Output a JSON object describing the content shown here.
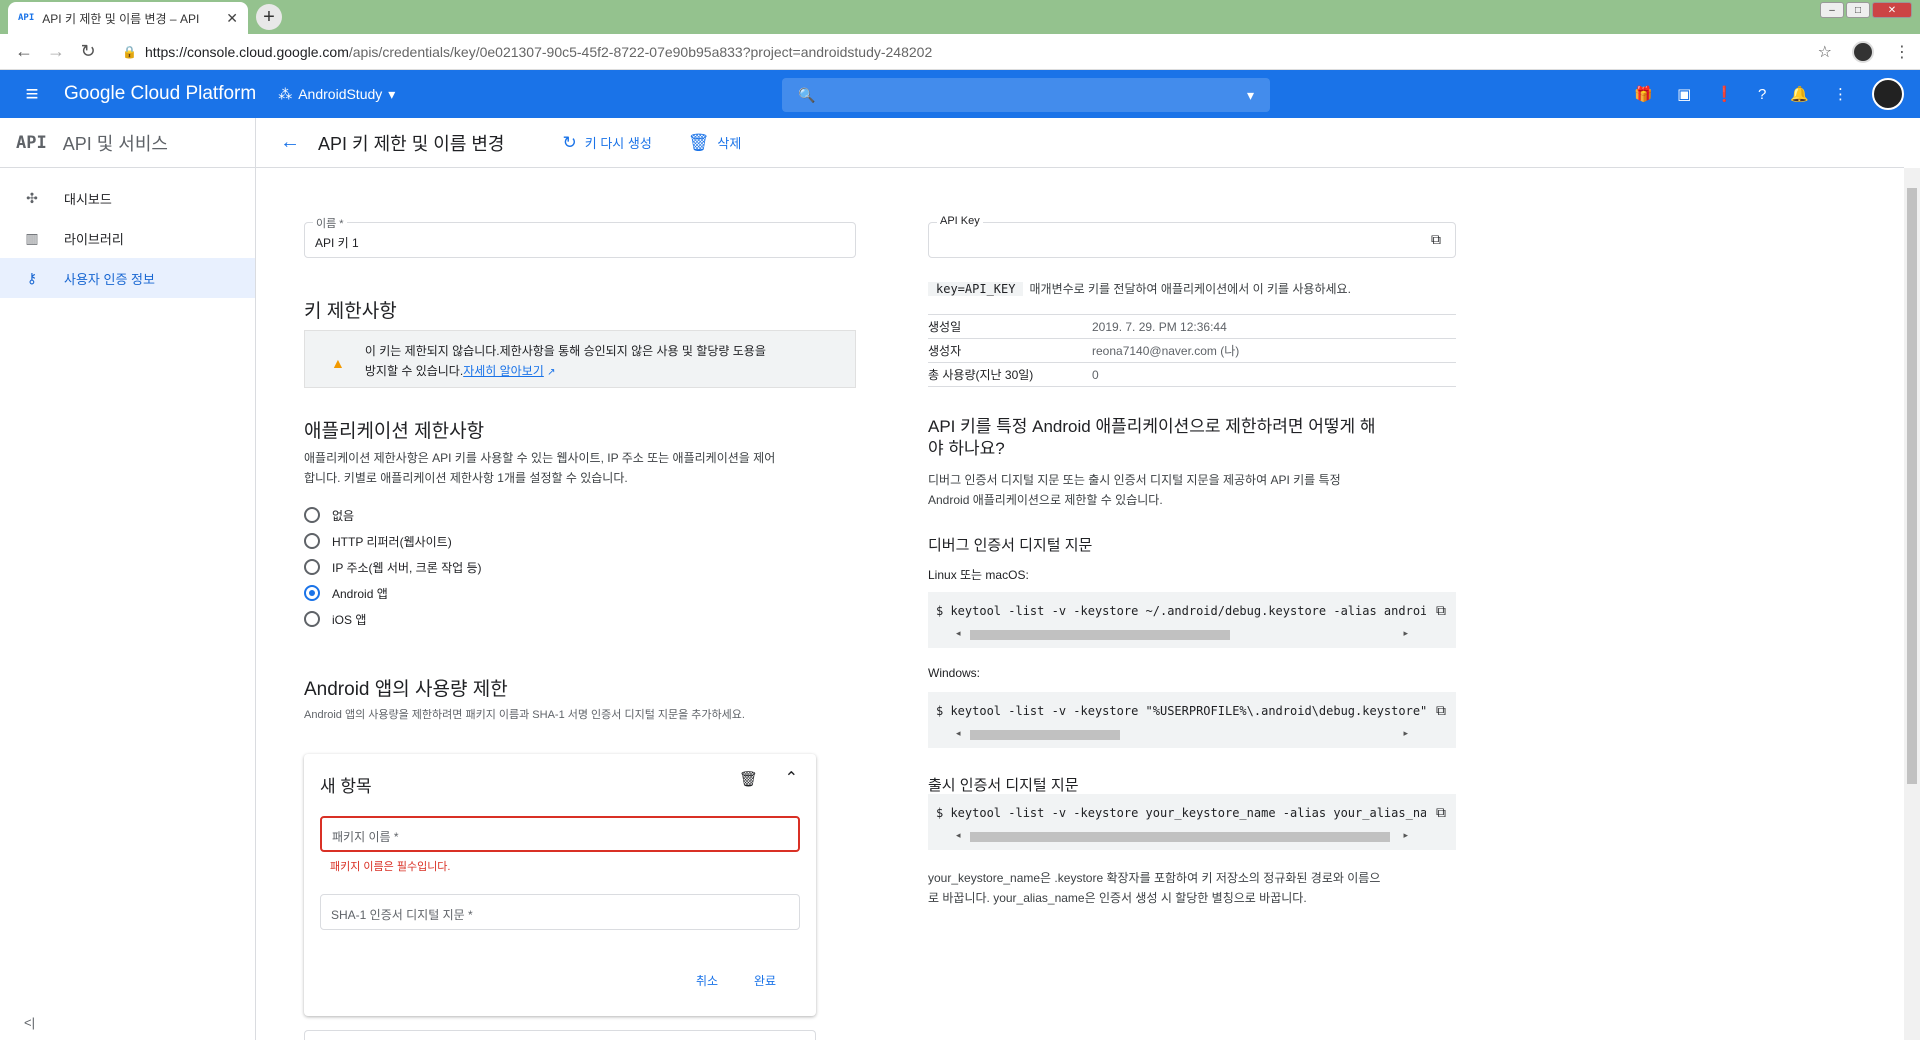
{
  "browser": {
    "tab_title": "API 키 제한 및 이름 변경 – API",
    "tab_favicon": "API",
    "url_host": "https://console.cloud.google.com",
    "url_path": "/apis/credentials/key/0e021307-90c5-45f2-8722-07e90b95a833?project=androidstudy-248202"
  },
  "header": {
    "brand": "Google Cloud Platform",
    "project": "AndroidStudy",
    "accent": "#1a73e8"
  },
  "sidebar": {
    "api_badge": "API",
    "title": "API 및 서비스",
    "items": [
      {
        "label": "대시보드",
        "icon": "dashboard-icon"
      },
      {
        "label": "라이브러리",
        "icon": "library-icon"
      },
      {
        "label": "사용자 인증 정보",
        "icon": "key-icon"
      }
    ]
  },
  "toolbar": {
    "title": "API 키 제한 및 이름 변경",
    "regenerate": "키 다시 생성",
    "delete": "삭제"
  },
  "left": {
    "name_label": "이름 *",
    "name_value": "API 키 1",
    "key_restrictions_title": "키 제한사항",
    "warning_line1": "이 키는 제한되지 않습니다.제한사항을 통해 승인되지 않은 사용 및 할당량 도용을",
    "warning_line2": "방지할 수 있습니다.",
    "learn_more": "자세히 알아보기",
    "app_restrictions_title": "애플리케이션 제한사항",
    "app_restrictions_desc1": "애플리케이션 제한사항은 API 키를 사용할 수 있는 웹사이트, IP 주소 또는 애플리케이션을 제어",
    "app_restrictions_desc2": "합니다. 키별로 애플리케이션 제한사항 1개를 설정할 수 있습니다.",
    "options": [
      "없음",
      "HTTP 리퍼러(웹사이트)",
      "IP 주소(웹 서버, 크론 작업 등)",
      "Android 앱",
      "iOS 앱"
    ],
    "selected_option": "Android 앱",
    "android_title": "Android 앱의 사용량 제한",
    "android_desc": "Android 앱의 사용량을 제한하려면 패키지 이름과 SHA-1 서명 인증서 디지털 지문을 추가하세요.",
    "new_item_title": "새 항목",
    "package_placeholder": "패키지 이름 *",
    "package_error": "패키지 이름은 필수입니다.",
    "sha1_placeholder": "SHA-1 인증서 디지털 지문 *",
    "cancel": "취소",
    "done": "완료",
    "error_color": "#d93025"
  },
  "right": {
    "apikey_label": "API Key",
    "param_code": "key=API_KEY",
    "param_text": "매개변수로 키를 전달하여 애플리케이션에서 이 키를 사용하세요.",
    "meta": [
      {
        "k": "생성일",
        "v": "2019. 7. 29. PM 12:36:44"
      },
      {
        "k": "생성자",
        "v": "reona7140@naver.com (나)"
      },
      {
        "k": "총 사용량(지난 30일)",
        "v": "0"
      }
    ],
    "howto_title1": "API 키를 특정 Android 애플리케이션으로 제한하려면 어떻게 해",
    "howto_title2": "야 하나요?",
    "howto_desc1": "디버그 인증서 디지털 지문 또는 출시 인증서 디지털 지문을 제공하여 API 키를 특정",
    "howto_desc2": "Android 애플리케이션으로 제한할 수 있습니다.",
    "debug_title": "디버그 인증서 디지털 지문",
    "linux_label": "Linux 또는 macOS:",
    "linux_cmd": "$ keytool -list -v -keystore ~/.android/debug.keystore -alias androi",
    "windows_label": "Windows:",
    "windows_cmd": "$ keytool -list -v -keystore \"%USERPROFILE%\\.android\\debug.keystore\"",
    "release_title": "출시 인증서 디지털 지문",
    "release_cmd": "$ keytool -list -v -keystore your_keystore_name -alias your_alias_na",
    "release_note1": "your_keystore_name은 .keystore 확장자를 포함하여 키 저장소의 정규화된 경로와 이름으",
    "release_note2": "로 바꿉니다. your_alias_name은 인증서 생성 시 할당한 별칭으로 바꿉니다."
  }
}
